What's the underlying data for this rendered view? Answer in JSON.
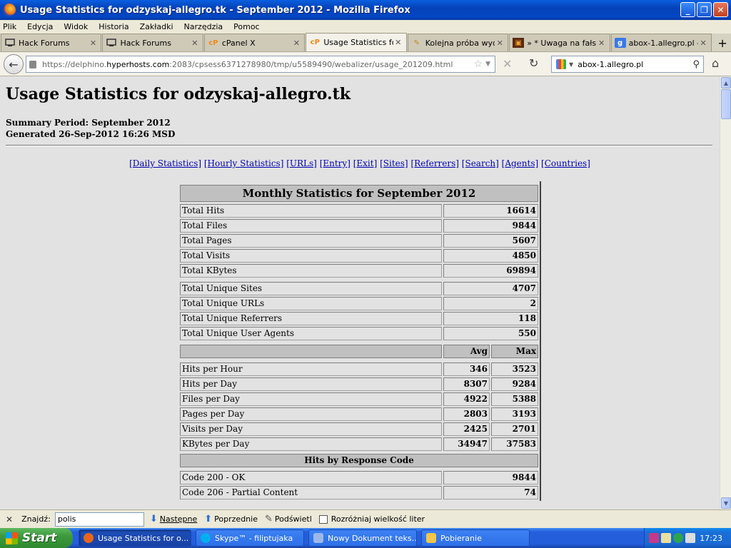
{
  "window": {
    "title": "Usage Statistics for odzyskaj-allegro.tk - September 2012 - Mozilla Firefox"
  },
  "menu": [
    "Plik",
    "Edycja",
    "Widok",
    "Historia",
    "Zakładki",
    "Narzędzia",
    "Pomoc"
  ],
  "tabs": [
    {
      "label": "Hack Forums",
      "icon": "hackforums-icon"
    },
    {
      "label": "Hack Forums",
      "icon": "hackforums-icon"
    },
    {
      "label": "cPanel X",
      "icon": "cpanel-icon"
    },
    {
      "label": "Usage Statistics fo...",
      "icon": "cpanel-icon",
      "active": true
    },
    {
      "label": "Kolejna próba wyci...",
      "icon": "forum-icon"
    },
    {
      "label": "» * Uwaga na fałs...",
      "icon": "forum-icon"
    },
    {
      "label": "abox-1.allegro.pl -...",
      "icon": "google-icon"
    }
  ],
  "nav": {
    "url_prefix": "https://delphino.",
    "url_domain": "hyperhosts.com",
    "url_rest": ":2083/cpsess6371278980/tmp/u5589490/webalizer/usage_201209.html",
    "search_value": "abox-1.allegro.pl"
  },
  "page": {
    "title": "Usage Statistics for odzyskaj-allegro.tk",
    "summary_period": "Summary Period: September 2012",
    "generated": "Generated 26-Sep-2012 16:26 MSD",
    "links": [
      "[Daily Statistics]",
      "[Hourly Statistics]",
      "[URLs]",
      "[Entry]",
      "[Exit]",
      "[Sites]",
      "[Referrers]",
      "[Search]",
      "[Agents]",
      "[Countries]"
    ],
    "monthly_title": "Monthly Statistics for September 2012",
    "totals": [
      {
        "label": "Total Hits",
        "value": "16614"
      },
      {
        "label": "Total Files",
        "value": "9844"
      },
      {
        "label": "Total Pages",
        "value": "5607"
      },
      {
        "label": "Total Visits",
        "value": "4850"
      },
      {
        "label": "Total KBytes",
        "value": "69894"
      }
    ],
    "uniques": [
      {
        "label": "Total Unique Sites",
        "value": "4707"
      },
      {
        "label": "Total Unique URLs",
        "value": "2"
      },
      {
        "label": "Total Unique Referrers",
        "value": "118"
      },
      {
        "label": "Total Unique User Agents",
        "value": "550"
      }
    ],
    "avg_label": "Avg",
    "max_label": "Max",
    "rates": [
      {
        "label": "Hits per Hour",
        "avg": "346",
        "max": "3523"
      },
      {
        "label": "Hits per Day",
        "avg": "8307",
        "max": "9284"
      },
      {
        "label": "Files per Day",
        "avg": "4922",
        "max": "5388"
      },
      {
        "label": "Pages per Day",
        "avg": "2803",
        "max": "3193"
      },
      {
        "label": "Visits per Day",
        "avg": "2425",
        "max": "2701"
      },
      {
        "label": "KBytes per Day",
        "avg": "34947",
        "max": "37583"
      }
    ],
    "response_title": "Hits by Response Code",
    "responses": [
      {
        "label": "Code 200 - OK",
        "value": "9844"
      },
      {
        "label": "Code 206 - Partial Content",
        "value": "74"
      }
    ]
  },
  "findbar": {
    "label": "Znajdź:",
    "value": "polis",
    "next": "Następne",
    "prev": "Poprzednie",
    "highlight": "Podświetl",
    "match_case": "Rozróżniaj wielkość liter"
  },
  "taskbar": {
    "start": "Start",
    "tasks": [
      {
        "label": "Usage Statistics for o...",
        "active": true,
        "color": "#e8661a"
      },
      {
        "label": "Skype™ - filiptujaka",
        "active": false,
        "color": "#00aff0"
      },
      {
        "label": "Nowy Dokument teks...",
        "active": false,
        "color": "#9bb8e8"
      },
      {
        "label": "Pobieranie",
        "active": false,
        "color": "#f3c54a"
      }
    ],
    "clock": "17:23"
  }
}
